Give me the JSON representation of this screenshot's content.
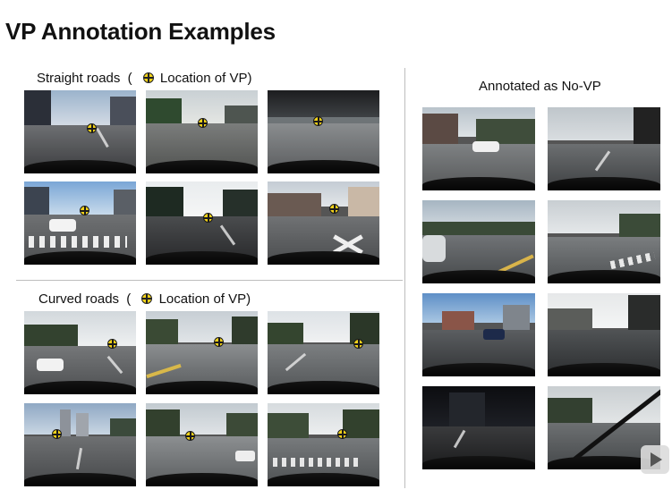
{
  "title": "VP Annotation Examples",
  "sections": {
    "straight": {
      "label": "Straight roads",
      "paren_open": "(",
      "legend": "Location of VP)"
    },
    "curved": {
      "label": "Curved roads",
      "paren_open": "(",
      "legend": "Location of VP)"
    },
    "novp": {
      "label": "Annotated as No-VP"
    }
  },
  "icons": {
    "vp_marker": "crosshair-circle-icon",
    "play": "play-icon"
  },
  "colors": {
    "vp_marker": "#f2d21a",
    "divider": "#bdbdbd"
  }
}
